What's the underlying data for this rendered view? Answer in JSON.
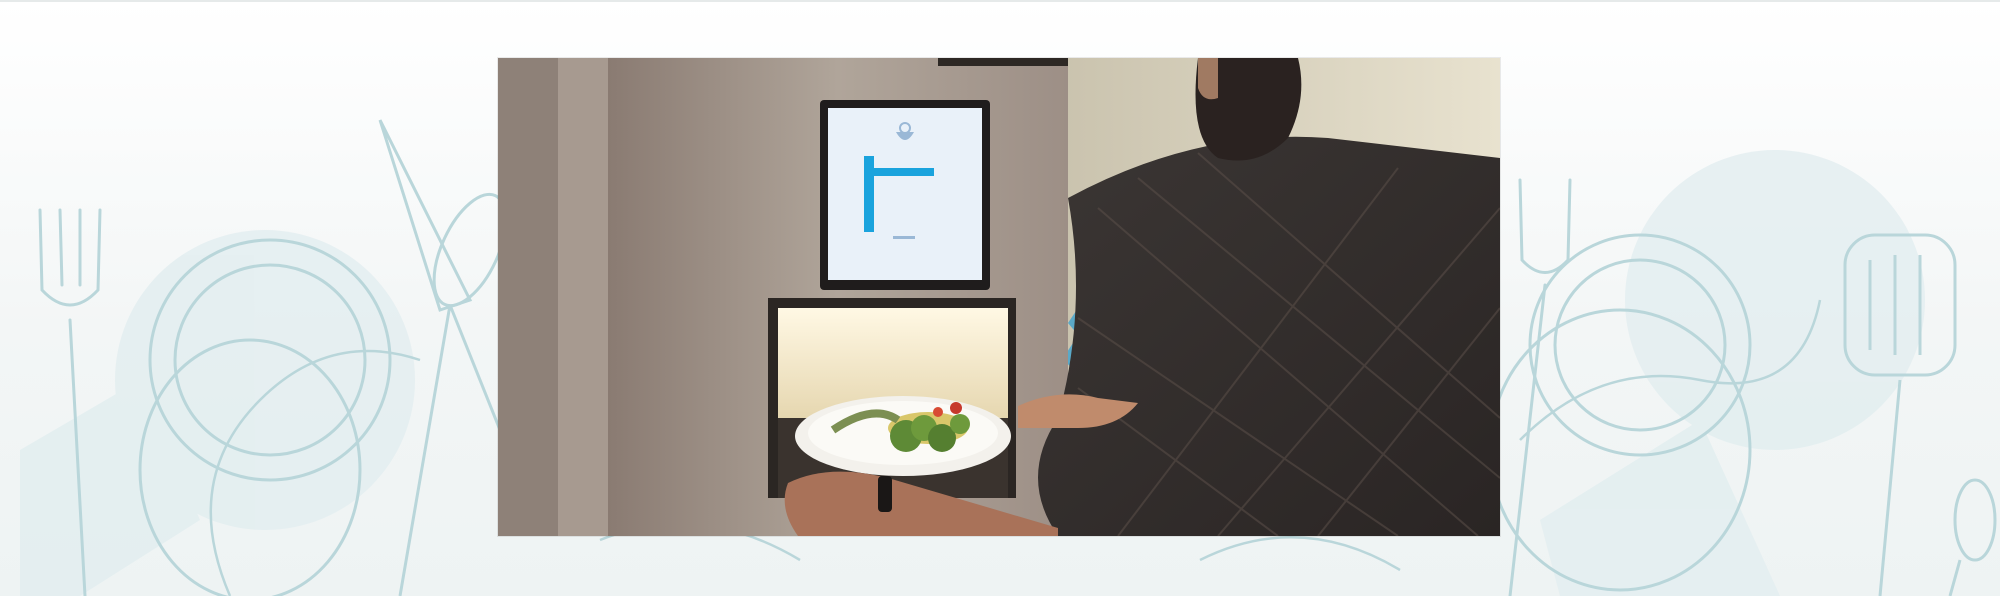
{
  "page": {
    "background_color": "#f3f6f6",
    "line_art_color": "#b9d6da",
    "fill_tint_color": "#e2eef0"
  },
  "decorations": {
    "left_group": [
      "fork-icon",
      "plate-icon",
      "spoon-icon",
      "knife-icon"
    ],
    "right_group": [
      "plate-icon",
      "spatula-icon",
      "spoon-icon",
      "fork-icon"
    ]
  },
  "photo": {
    "subject": "man-at-food-kiosk",
    "objects": [
      "kiosk-cabinet",
      "touch-screen",
      "serving-window",
      "plate-of-vegetables",
      "bearded-man",
      "plaid-shirt"
    ]
  },
  "screen": {
    "background_color": "#e9f1f9",
    "accent_color": "#1aa3dd",
    "logo_icon": "bowl-logo-icon"
  }
}
